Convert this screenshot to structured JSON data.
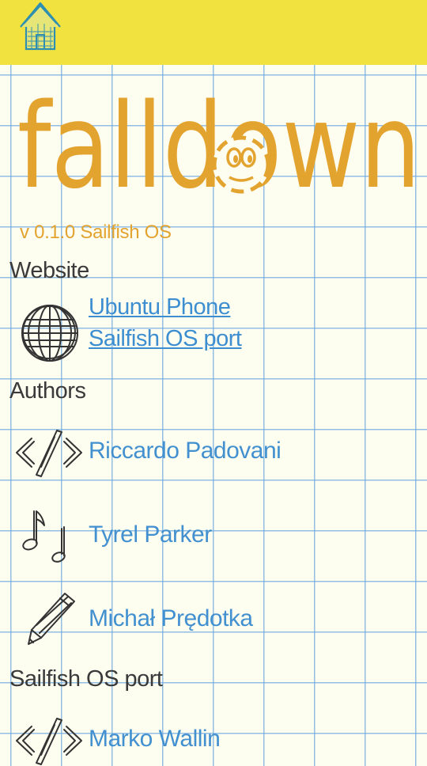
{
  "header": {
    "home_icon": "house-icon",
    "color": "#f1e240"
  },
  "logo": {
    "text": "falldown"
  },
  "version": "v 0.1.0 Sailfish OS",
  "website": {
    "heading": "Website",
    "icon": "globe-icon",
    "links": [
      "Ubuntu Phone",
      "Sailfish OS port"
    ]
  },
  "authors": {
    "heading": "Authors",
    "items": [
      {
        "name": "Riccardo Padovani",
        "icon": "code-icon"
      },
      {
        "name": "Tyrel Parker",
        "icon": "music-note-icon"
      },
      {
        "name": "Michał Prędotka",
        "icon": "pencil-icon"
      }
    ]
  },
  "port": {
    "heading": "Sailfish OS port",
    "items": [
      {
        "name": "Marko Wallin",
        "icon": "code-icon"
      }
    ]
  },
  "colors": {
    "accent": "#e3a32f",
    "link": "#3d8ed0",
    "grid": "#6eaae1",
    "paper": "#fdfdf0"
  }
}
